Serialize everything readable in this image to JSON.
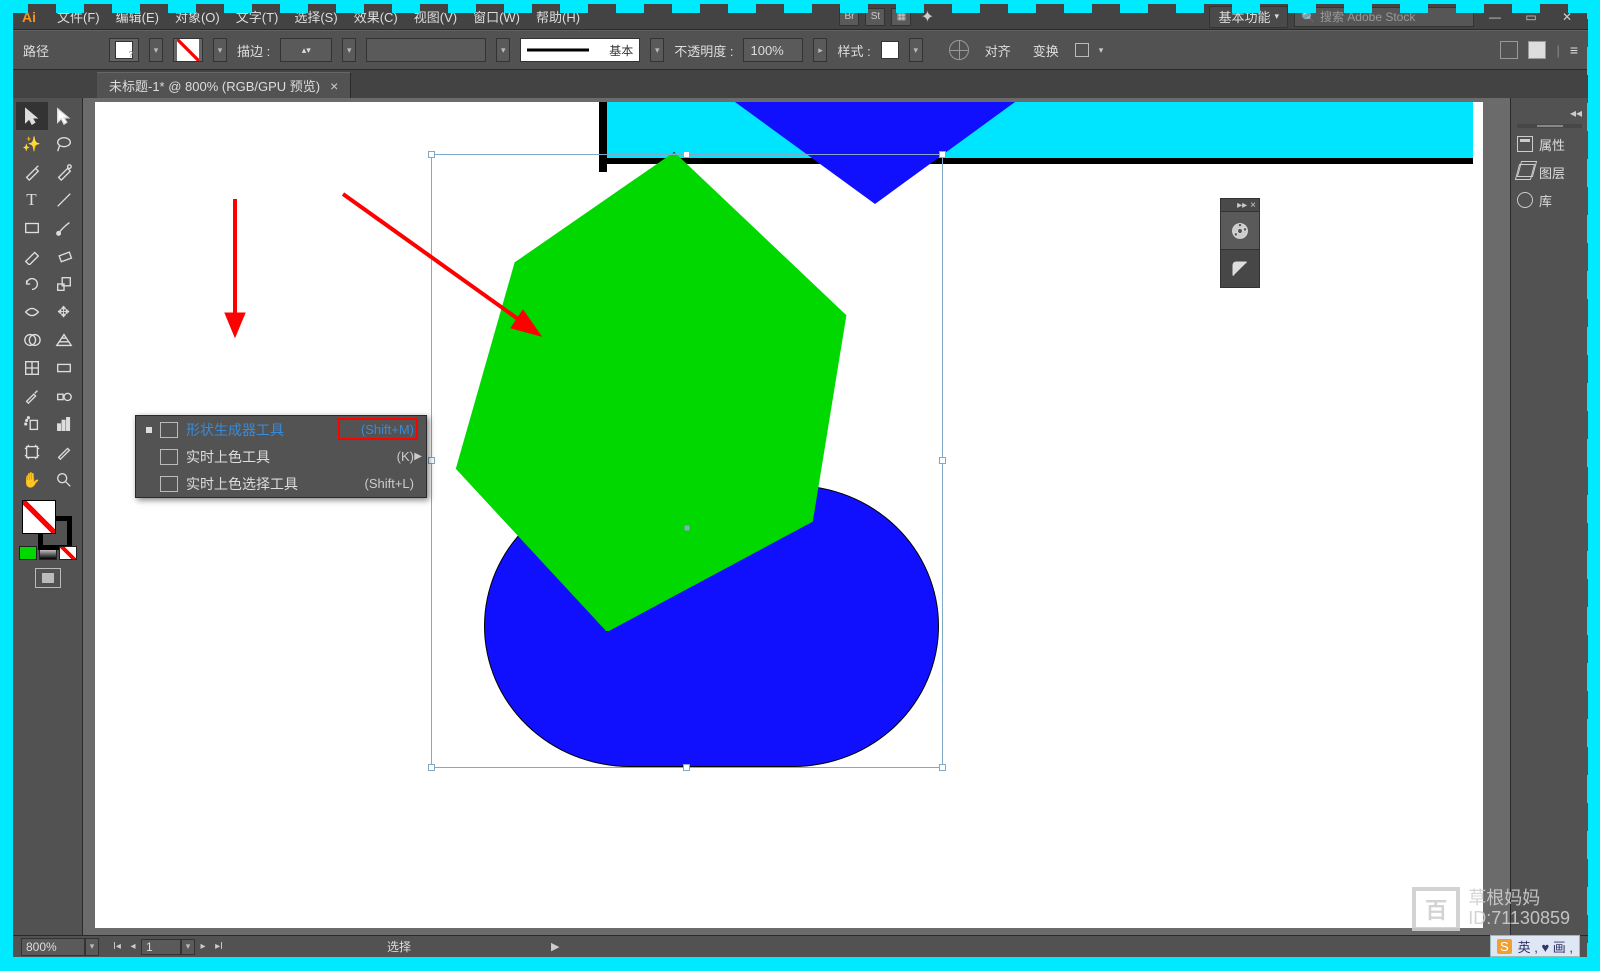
{
  "app_name": "Ai",
  "menu": [
    "文件(F)",
    "编辑(E)",
    "对象(O)",
    "文字(T)",
    "选择(S)",
    "效果(C)",
    "视图(V)",
    "窗口(W)",
    "帮助(H)"
  ],
  "right_menu": {
    "br": "Br",
    "st": "St",
    "workspace": "基本功能",
    "search_placeholder": "搜索 Adobe Stock"
  },
  "options": {
    "label": "路径",
    "stroke_label": "描边 :",
    "stroke_style": "基本",
    "opacity_label": "不透明度 :",
    "opacity_value": "100%",
    "style_label": "样式 :",
    "align_label": "对齐",
    "transform_label": "变换"
  },
  "tab": {
    "title": "未标题-1* @ 800% (RGB/GPU 预览)"
  },
  "flyout": {
    "items": [
      {
        "label": "形状生成器工具",
        "shortcut": "(Shift+M)",
        "active": true
      },
      {
        "label": "实时上色工具",
        "shortcut": "(K)",
        "submenu": true
      },
      {
        "label": "实时上色选择工具",
        "shortcut": "(Shift+L)"
      }
    ]
  },
  "right_panel": {
    "items": [
      {
        "label": "属性"
      },
      {
        "label": "图层"
      },
      {
        "label": "库"
      }
    ]
  },
  "status": {
    "zoom": "800%",
    "artboard": "1",
    "mode": "选择"
  },
  "watermark": {
    "line1": "草根妈妈",
    "line2": "ID:71130859",
    "logo": "百"
  },
  "ime": "英 , ♥ 画 ,",
  "colors": {
    "green": "#00d800",
    "blue": "#1010ff",
    "cyan": "#00e5ff"
  }
}
